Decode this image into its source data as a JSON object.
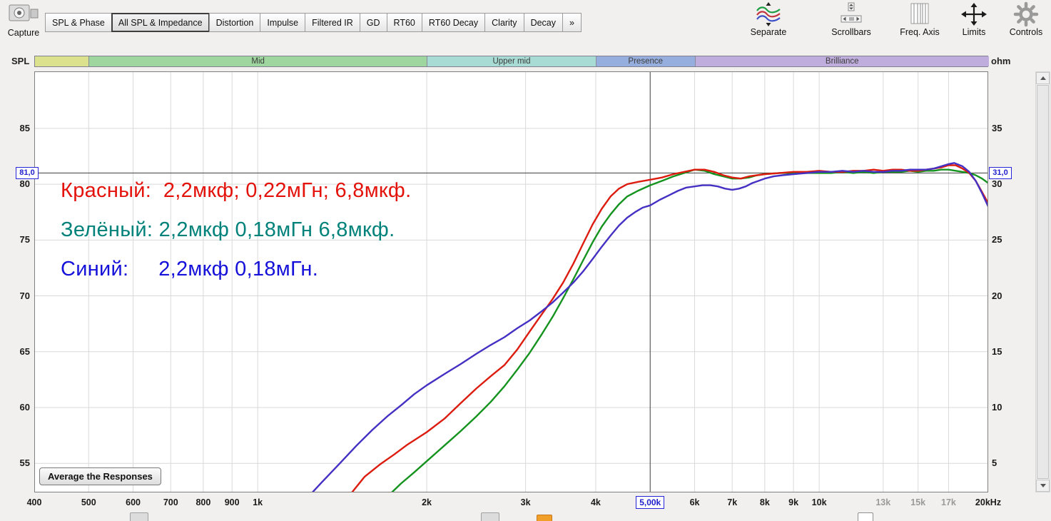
{
  "toolbar": {
    "capture_label": "Capture",
    "tabs": [
      "SPL & Phase",
      "All SPL & Impedance",
      "Distortion",
      "Impulse",
      "Filtered IR",
      "GD",
      "RT60",
      "RT60 Decay",
      "Clarity",
      "Decay",
      "»"
    ],
    "active_tab_index": 1,
    "tools": [
      "Separate",
      "Scrollbars",
      "Freq. Axis",
      "Limits",
      "Controls"
    ]
  },
  "chart": {
    "left_axis": {
      "label": "SPL",
      "ticks": [
        85,
        80,
        75,
        70,
        65,
        60,
        55
      ]
    },
    "right_axis": {
      "label": "ohm",
      "ticks": [
        35,
        30,
        25,
        20,
        15,
        10,
        5
      ]
    },
    "bands": [
      {
        "label": "",
        "f1": 400,
        "f2": 500,
        "color": "#dce18d"
      },
      {
        "label": "Mid",
        "f1": 500,
        "f2": 2000,
        "color": "#9fd69f"
      },
      {
        "label": "Upper mid",
        "f1": 2000,
        "f2": 4000,
        "color": "#a7dbd3"
      },
      {
        "label": "Presence",
        "f1": 4000,
        "f2": 6000,
        "color": "#96aedd"
      },
      {
        "label": "Brilliance",
        "f1": 6000,
        "f2": 20000,
        "color": "#bfaedd"
      }
    ],
    "x_ticks": [
      {
        "f": 400,
        "label": "400"
      },
      {
        "f": 500,
        "label": "500"
      },
      {
        "f": 600,
        "label": "600"
      },
      {
        "f": 700,
        "label": "700"
      },
      {
        "f": 800,
        "label": "800"
      },
      {
        "f": 900,
        "label": "900"
      },
      {
        "f": 1000,
        "label": "1k"
      },
      {
        "f": 2000,
        "label": "2k"
      },
      {
        "f": 3000,
        "label": "3k"
      },
      {
        "f": 4000,
        "label": "4k"
      },
      {
        "f": 6000,
        "label": "6k"
      },
      {
        "f": 7000,
        "label": "7k"
      },
      {
        "f": 8000,
        "label": "8k"
      },
      {
        "f": 9000,
        "label": "9k"
      },
      {
        "f": 10000,
        "label": "10k"
      },
      {
        "f": 13000,
        "label": "13k",
        "minor": true
      },
      {
        "f": 15000,
        "label": "15k",
        "minor": true
      },
      {
        "f": 17000,
        "label": "17k",
        "minor": true
      },
      {
        "f": 20000,
        "label": "20kHz"
      }
    ],
    "cursor": {
      "freq": 5000,
      "freq_label": "5,00k",
      "spl": 81.0,
      "spl_label": "81,0",
      "ohm_label": "31,0"
    },
    "annotations": [
      {
        "text": "Красный:  2,2мкф; 0,22мГн; 6,8мкф.",
        "color": "#e3120b"
      },
      {
        "text": "Зелёный: 2,2мкф 0,18мГн 6,8мкф.",
        "color": "#00827a"
      },
      {
        "text": "Синий:     2,2мкф 0,18мГн.",
        "color": "#1511d9"
      }
    ],
    "average_button": "Average the Responses"
  },
  "chart_data": {
    "type": "line",
    "x_scale": "log",
    "xlim": [
      400,
      20000
    ],
    "ylim_spl": [
      52.4,
      90.1
    ],
    "ylim_ohm": [
      2.4,
      40.1
    ],
    "x_unit": "Hz",
    "y_unit_left": "dB SPL",
    "y_unit_right": "ohm",
    "grid": true,
    "cursor": {
      "freq_hz": 5000,
      "spl_db": 81.0,
      "ohm": 31.0
    },
    "series": [
      {
        "name": "Красный (2,2мкф; 0,22мГн; 6,8мкф)",
        "color": "#15931f",
        "points": [
          [
            1700,
            52
          ],
          [
            1800,
            53.2
          ],
          [
            1900,
            54.2
          ],
          [
            2000,
            55.2
          ],
          [
            2150,
            56.6
          ],
          [
            2300,
            57.9
          ],
          [
            2450,
            59.2
          ],
          [
            2600,
            60.5
          ],
          [
            2750,
            61.9
          ],
          [
            2900,
            63.4
          ],
          [
            3050,
            64.9
          ],
          [
            3200,
            66.5
          ],
          [
            3350,
            68.1
          ],
          [
            3500,
            69.8
          ],
          [
            3650,
            71.5
          ],
          [
            3800,
            73.2
          ],
          [
            3950,
            74.8
          ],
          [
            4100,
            76.2
          ],
          [
            4250,
            77.3
          ],
          [
            4400,
            78.2
          ],
          [
            4550,
            78.9
          ],
          [
            4750,
            79.4
          ],
          [
            5000,
            79.9
          ],
          [
            5250,
            80.3
          ],
          [
            5500,
            80.7
          ],
          [
            5750,
            81.0
          ],
          [
            6000,
            81.3
          ],
          [
            6250,
            81.2
          ],
          [
            6500,
            80.9
          ],
          [
            6750,
            80.7
          ],
          [
            7000,
            80.5
          ],
          [
            7250,
            80.5
          ],
          [
            7500,
            80.6
          ],
          [
            7750,
            80.8
          ],
          [
            8000,
            80.9
          ],
          [
            8500,
            81.0
          ],
          [
            9000,
            81.0
          ],
          [
            9500,
            81.0
          ],
          [
            10000,
            81.0
          ],
          [
            10500,
            81.0
          ],
          [
            11000,
            81.1
          ],
          [
            11500,
            81.0
          ],
          [
            12000,
            81.1
          ],
          [
            12500,
            81.0
          ],
          [
            13000,
            81.1
          ],
          [
            13500,
            81.1
          ],
          [
            14000,
            81.1
          ],
          [
            14500,
            81.2
          ],
          [
            15000,
            81.1
          ],
          [
            15500,
            81.2
          ],
          [
            16000,
            81.2
          ],
          [
            16500,
            81.3
          ],
          [
            17000,
            81.3
          ],
          [
            17500,
            81.2
          ],
          [
            18000,
            81.1
          ],
          [
            18500,
            81.0
          ],
          [
            19000,
            80.8
          ],
          [
            19500,
            80.5
          ],
          [
            20000,
            80.1
          ]
        ],
        "swap_note": "green curve"
      },
      {
        "name": "Красный: 2,2мкф; 0,22мГн; 6,8мкф",
        "color": "#dd1c10",
        "points": [
          [
            1450,
            52
          ],
          [
            1550,
            53.8
          ],
          [
            1650,
            54.9
          ],
          [
            1750,
            55.8
          ],
          [
            1850,
            56.7
          ],
          [
            2000,
            57.8
          ],
          [
            2150,
            59.0
          ],
          [
            2300,
            60.4
          ],
          [
            2450,
            61.7
          ],
          [
            2600,
            62.8
          ],
          [
            2750,
            63.8
          ],
          [
            2900,
            65.2
          ],
          [
            3050,
            66.8
          ],
          [
            3200,
            68.3
          ],
          [
            3350,
            69.7
          ],
          [
            3500,
            71.2
          ],
          [
            3650,
            72.9
          ],
          [
            3800,
            74.7
          ],
          [
            3950,
            76.4
          ],
          [
            4100,
            77.8
          ],
          [
            4250,
            78.9
          ],
          [
            4400,
            79.6
          ],
          [
            4550,
            80.0
          ],
          [
            4750,
            80.2
          ],
          [
            5000,
            80.4
          ],
          [
            5250,
            80.6
          ],
          [
            5500,
            80.9
          ],
          [
            5750,
            81.1
          ],
          [
            6000,
            81.3
          ],
          [
            6250,
            81.3
          ],
          [
            6500,
            81.1
          ],
          [
            6750,
            80.8
          ],
          [
            7000,
            80.6
          ],
          [
            7250,
            80.5
          ],
          [
            7500,
            80.7
          ],
          [
            7750,
            80.8
          ],
          [
            8000,
            80.9
          ],
          [
            8500,
            81.0
          ],
          [
            9000,
            81.1
          ],
          [
            9500,
            81.1
          ],
          [
            10000,
            81.2
          ],
          [
            10500,
            81.1
          ],
          [
            11000,
            81.1
          ],
          [
            11500,
            81.2
          ],
          [
            12000,
            81.2
          ],
          [
            12500,
            81.3
          ],
          [
            13000,
            81.2
          ],
          [
            13500,
            81.3
          ],
          [
            14000,
            81.3
          ],
          [
            14500,
            81.2
          ],
          [
            15000,
            81.2
          ],
          [
            15500,
            81.3
          ],
          [
            16000,
            81.4
          ],
          [
            16500,
            81.5
          ],
          [
            17000,
            81.7
          ],
          [
            17500,
            81.7
          ],
          [
            18000,
            81.4
          ],
          [
            18500,
            81.0
          ],
          [
            19000,
            80.3
          ],
          [
            19500,
            79.3
          ],
          [
            20000,
            78.3
          ]
        ]
      },
      {
        "name": "Синий: 2,2мкф 0,18мГн",
        "color": "#4431c4",
        "points": [
          [
            1230,
            52
          ],
          [
            1300,
            53.3
          ],
          [
            1400,
            55.0
          ],
          [
            1500,
            56.6
          ],
          [
            1600,
            58.0
          ],
          [
            1700,
            59.2
          ],
          [
            1800,
            60.2
          ],
          [
            1900,
            61.2
          ],
          [
            2000,
            62.0
          ],
          [
            2150,
            63.0
          ],
          [
            2300,
            63.9
          ],
          [
            2450,
            64.8
          ],
          [
            2600,
            65.6
          ],
          [
            2750,
            66.3
          ],
          [
            2900,
            67.1
          ],
          [
            3050,
            67.8
          ],
          [
            3200,
            68.6
          ],
          [
            3350,
            69.4
          ],
          [
            3500,
            70.3
          ],
          [
            3650,
            71.2
          ],
          [
            3800,
            72.2
          ],
          [
            3950,
            73.3
          ],
          [
            4100,
            74.4
          ],
          [
            4250,
            75.4
          ],
          [
            4400,
            76.3
          ],
          [
            4550,
            77.0
          ],
          [
            4700,
            77.5
          ],
          [
            4850,
            77.9
          ],
          [
            5000,
            78.1
          ],
          [
            5200,
            78.6
          ],
          [
            5400,
            79.0
          ],
          [
            5600,
            79.4
          ],
          [
            5800,
            79.7
          ],
          [
            6000,
            79.8
          ],
          [
            6200,
            79.9
          ],
          [
            6400,
            79.9
          ],
          [
            6600,
            79.8
          ],
          [
            6800,
            79.6
          ],
          [
            7000,
            79.5
          ],
          [
            7200,
            79.6
          ],
          [
            7400,
            79.8
          ],
          [
            7600,
            80.1
          ],
          [
            7800,
            80.3
          ],
          [
            8000,
            80.5
          ],
          [
            8300,
            80.7
          ],
          [
            8600,
            80.8
          ],
          [
            9000,
            80.9
          ],
          [
            9500,
            81.0
          ],
          [
            10000,
            81.1
          ],
          [
            10500,
            81.1
          ],
          [
            11000,
            81.2
          ],
          [
            11500,
            81.1
          ],
          [
            12000,
            81.2
          ],
          [
            12500,
            81.1
          ],
          [
            13000,
            81.1
          ],
          [
            13500,
            81.2
          ],
          [
            14000,
            81.2
          ],
          [
            14500,
            81.3
          ],
          [
            15000,
            81.3
          ],
          [
            15500,
            81.3
          ],
          [
            16000,
            81.4
          ],
          [
            16500,
            81.6
          ],
          [
            17000,
            81.8
          ],
          [
            17400,
            81.9
          ],
          [
            18000,
            81.6
          ],
          [
            18500,
            81.1
          ],
          [
            19000,
            80.3
          ],
          [
            19500,
            79.2
          ],
          [
            20000,
            78.0
          ]
        ]
      }
    ]
  }
}
